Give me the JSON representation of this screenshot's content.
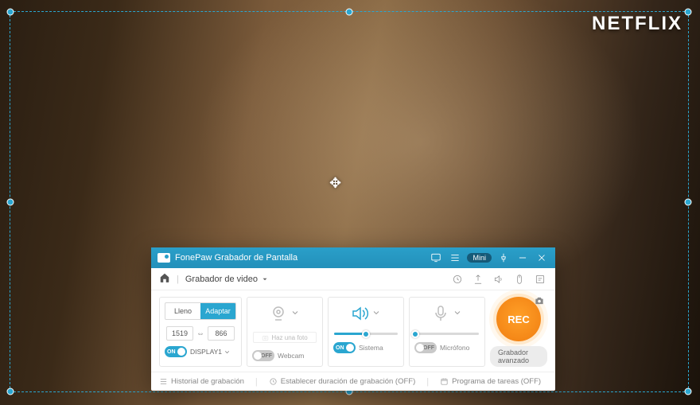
{
  "brand_logo": "NETFLIX",
  "titlebar": {
    "app_name": "FonePaw Grabador de Pantalla",
    "mini_label": "Mini"
  },
  "toolbar": {
    "mode_label": "Grabador de video"
  },
  "region": {
    "tab_full": "Lleno",
    "tab_custom": "Adaptar",
    "width": "1519",
    "height": "866",
    "toggle_state": "ON",
    "display_label": "DISPLAY1"
  },
  "webcam": {
    "take_photo": "Haz una foto",
    "toggle_state": "OFF",
    "label": "Webcam"
  },
  "system_sound": {
    "toggle_state": "ON",
    "label": "Sistema",
    "volume_percent": 50
  },
  "microphone": {
    "toggle_state": "OFF",
    "label": "Micrófono",
    "volume_percent": 0
  },
  "record": {
    "button": "REC",
    "advanced": "Grabador avanzado"
  },
  "footer": {
    "history": "Historial de grabación",
    "duration": "Establecer duración de grabación (OFF)",
    "schedule": "Programa de tareas (OFF)"
  }
}
